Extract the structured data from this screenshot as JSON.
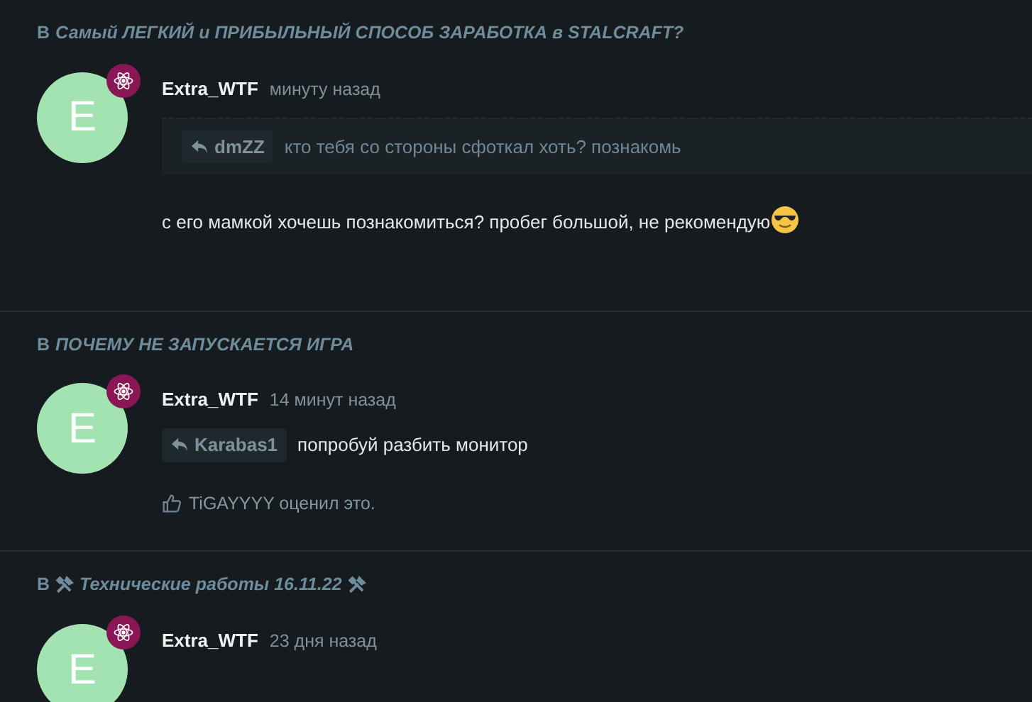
{
  "posts": [
    {
      "topic": {
        "prefix": "В",
        "parts": [
          {
            "kind": "text",
            "text": "Самый ЛЕГКИЙ и ПРИБЫЛЬНЫЙ СПОСОБ ЗАРАБОТКА в STALCRAFT?"
          }
        ]
      },
      "avatar_letter": "E",
      "author": "Extra_WTF",
      "time": "минуту назад",
      "quote": {
        "author": "dmZZ",
        "text": "кто тебя со стороны сфоткал хоть? познакомь"
      },
      "message": [
        {
          "kind": "text",
          "text": "с его мамкой хочешь познакомиться? пробег большой, не рекомендую"
        },
        {
          "kind": "emoji"
        }
      ]
    },
    {
      "topic": {
        "prefix": "В",
        "parts": [
          {
            "kind": "text",
            "text": "ПОЧЕМУ НЕ ЗАПУСКАЕТСЯ ИГРА"
          }
        ]
      },
      "avatar_letter": "E",
      "author": "Extra_WTF",
      "time": "14 минут назад",
      "reply_to": "Karabas1",
      "message": [
        {
          "kind": "text",
          "text": "попробуй разбить монитор"
        }
      ],
      "like_text": "TiGAYYYY оценил это."
    },
    {
      "topic": {
        "prefix": "В",
        "parts": [
          {
            "kind": "icon"
          },
          {
            "kind": "text",
            "text": "Технические работы 16.11.22"
          },
          {
            "kind": "icon"
          }
        ]
      },
      "avatar_letter": "E",
      "author": "Extra_WTF",
      "time": "23 дня назад"
    }
  ]
}
